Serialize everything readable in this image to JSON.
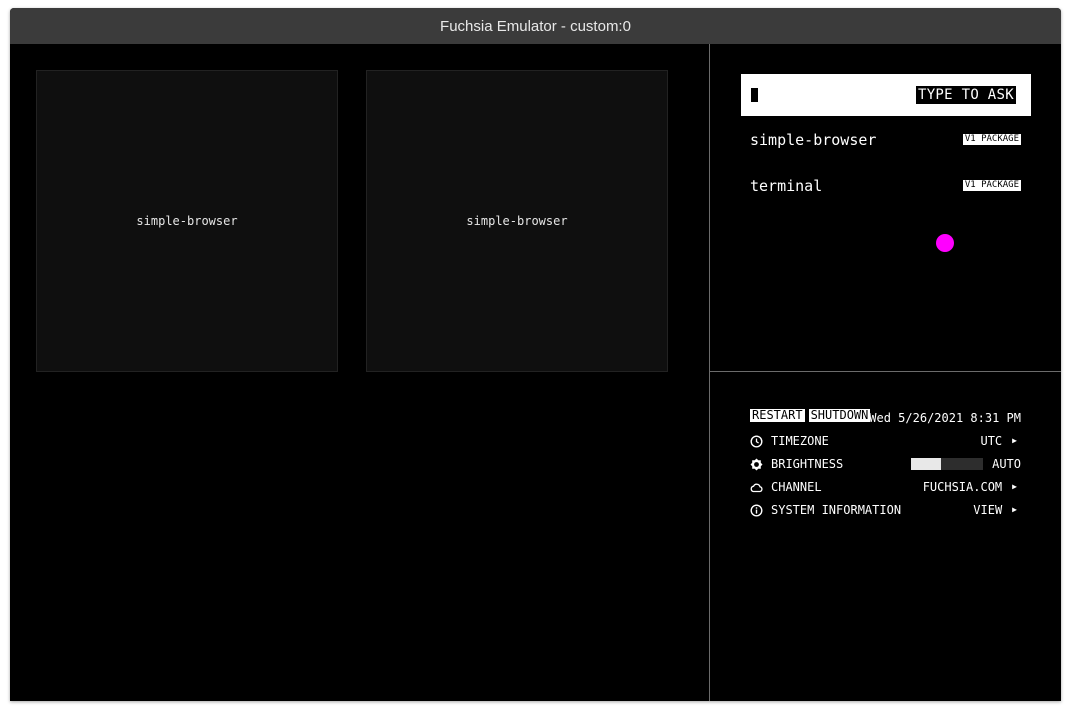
{
  "window": {
    "title": "Fuchsia Emulator - custom:0"
  },
  "tiles": [
    {
      "label": "simple-browser"
    },
    {
      "label": "simple-browser"
    }
  ],
  "ask": {
    "hint": "TYPE TO ASK",
    "suggestions": [
      {
        "name": "simple-browser",
        "tag": "V1 PACKAGE"
      },
      {
        "name": "terminal",
        "tag": "V1 PACKAGE"
      }
    ]
  },
  "quick_settings": {
    "restart_label": "RESTART",
    "shutdown_label": "SHUTDOWN",
    "datetime": "Wed 5/26/2021 8:31 PM",
    "timezone": {
      "label": "TIMEZONE",
      "value": "UTC",
      "icon": "clock-icon"
    },
    "brightness": {
      "label": "BRIGHTNESS",
      "value": "AUTO",
      "level": 0.42,
      "icon": "brightness-icon"
    },
    "channel": {
      "label": "CHANNEL",
      "value": "FUCHSIA.COM",
      "icon": "cloud-icon"
    },
    "system_information": {
      "label": "SYSTEM INFORMATION",
      "value": "VIEW",
      "icon": "info-icon"
    }
  },
  "colors": {
    "cursor": "#ff00ff",
    "background": "#000000",
    "titlebar": "#3b3b3b"
  }
}
